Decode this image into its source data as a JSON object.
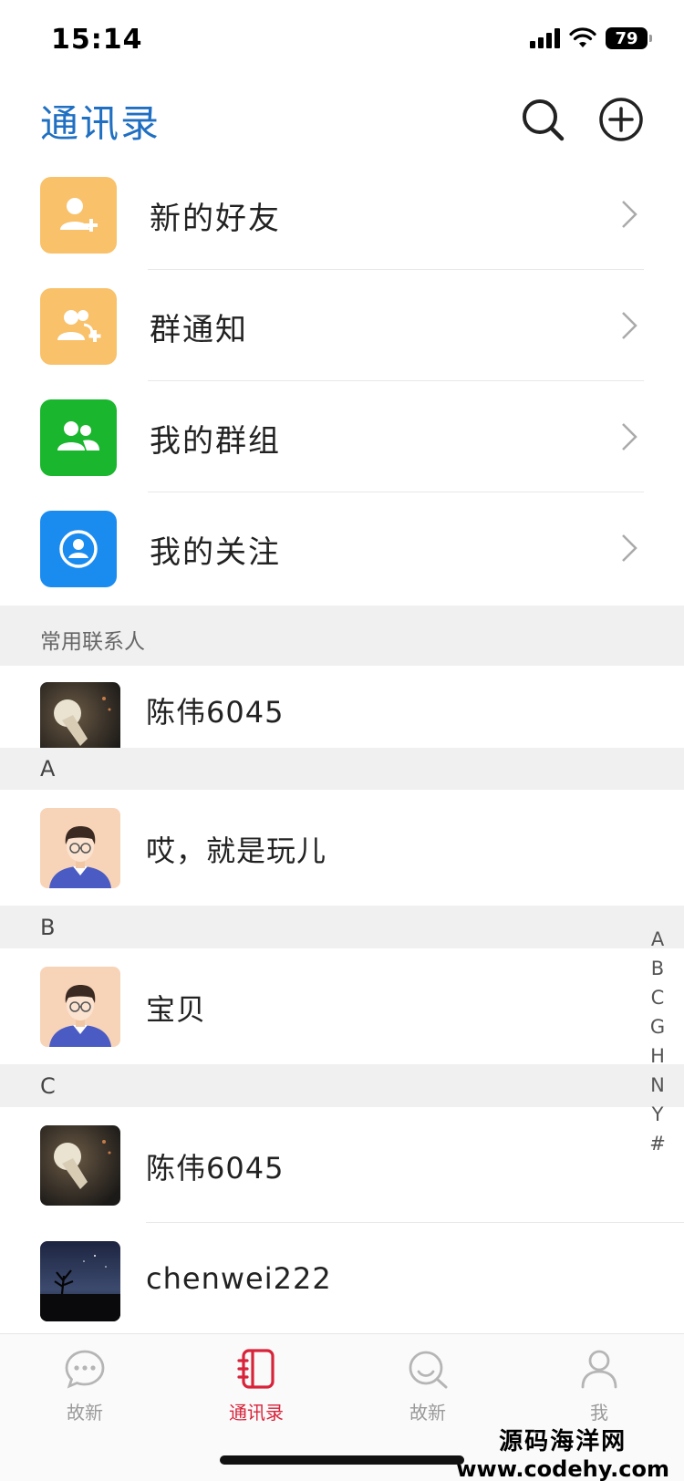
{
  "status_bar": {
    "time": "15:14",
    "battery": "79"
  },
  "header": {
    "title": "通讯录"
  },
  "menu": [
    {
      "label": "新的好友",
      "icon": "add-friend-icon",
      "color": "#f8c16a"
    },
    {
      "label": "群通知",
      "icon": "group-notice-icon",
      "color": "#f8c16a"
    },
    {
      "label": "我的群组",
      "icon": "my-groups-icon",
      "color": "#1ab62d"
    },
    {
      "label": "我的关注",
      "icon": "my-follows-icon",
      "color": "#1a8cf0"
    }
  ],
  "frequent": {
    "title": "常用联系人",
    "contacts": [
      {
        "name": "陈伟6045"
      }
    ]
  },
  "groups": [
    {
      "letter": "A",
      "contacts": [
        {
          "name": "哎，就是玩儿"
        }
      ]
    },
    {
      "letter": "B",
      "contacts": [
        {
          "name": "宝贝"
        }
      ]
    },
    {
      "letter": "C",
      "contacts": [
        {
          "name": "陈伟6045"
        },
        {
          "name": "chenwei222"
        }
      ]
    }
  ],
  "index_letters": [
    "A",
    "B",
    "C",
    "G",
    "H",
    "N",
    "Y",
    "#"
  ],
  "tabs": [
    {
      "label": "故新",
      "icon": "chat-icon",
      "active": false
    },
    {
      "label": "通讯录",
      "icon": "contacts-book-icon",
      "active": true
    },
    {
      "label": "故新",
      "icon": "discover-icon",
      "active": false
    },
    {
      "label": "我",
      "icon": "profile-icon",
      "active": false
    }
  ],
  "watermark": {
    "line1": "源码海洋网",
    "line2": "www.codehy.com"
  },
  "colors": {
    "title_blue": "#1f6fc2",
    "active_red": "#d8233a",
    "section_bg": "#f0f0f0"
  }
}
